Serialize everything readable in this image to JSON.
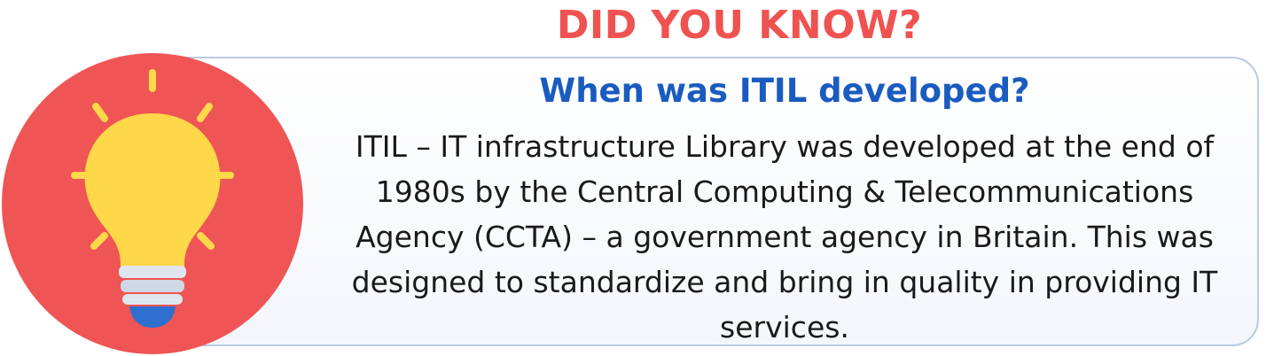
{
  "header": {
    "title": "DID YOU KNOW?"
  },
  "card": {
    "question": "When was ITIL developed?",
    "answer": "ITIL – IT infrastructure Library was developed at the end of 1980s by the Central Computing & Telecommunications Agency (CCTA) – a government agency in Britain. This was designed to standardize and bring in quality in providing IT services."
  },
  "icon": {
    "name": "lightbulb-icon"
  },
  "colors": {
    "title": "#ef5350",
    "question": "#1a5bbf",
    "circle": "#f05555",
    "bulb": "#ffd84a",
    "rays": "#ffd84a",
    "bulb_base_light": "#dfe6ef",
    "bulb_base_dark": "#2f6fd0",
    "card_border": "#b9cbe3"
  }
}
